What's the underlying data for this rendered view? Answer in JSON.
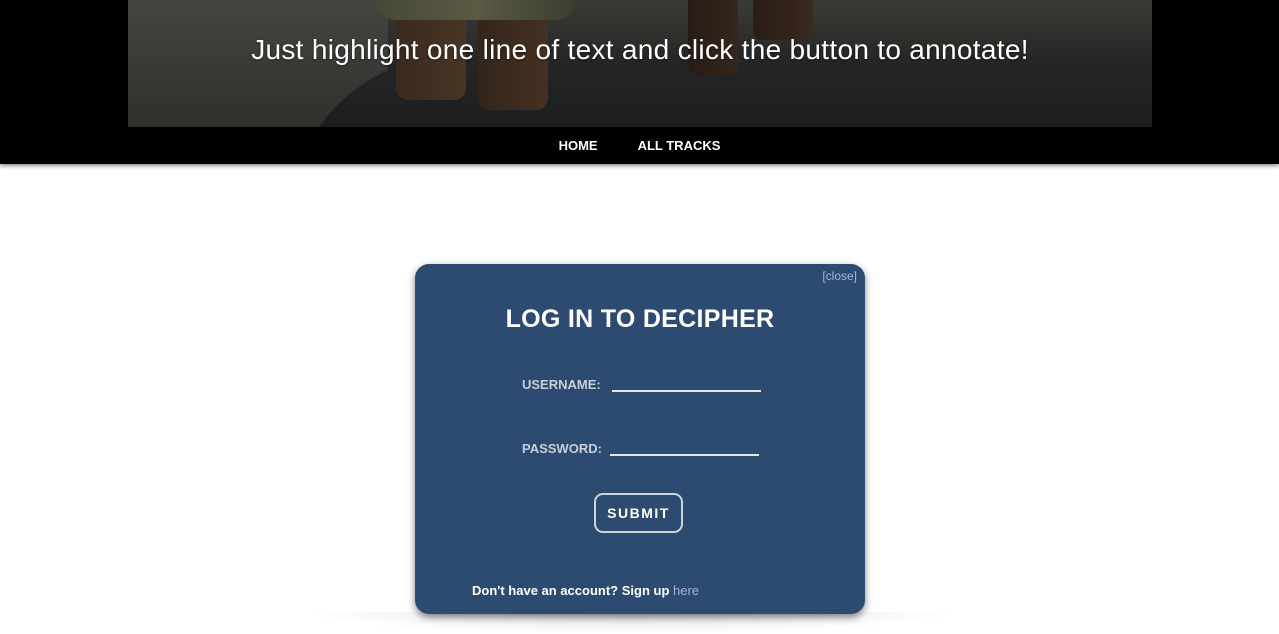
{
  "banner": {
    "text": "Just highlight one line of text and click the button to annotate!"
  },
  "nav": {
    "items": [
      {
        "label": "HOME"
      },
      {
        "label": "ALL TRACKS"
      }
    ]
  },
  "login_modal": {
    "close_label": "[close]",
    "title": "LOG IN TO DECIPHER",
    "username_label": "USERNAME:",
    "username_value": "",
    "password_label": "PASSWORD:",
    "password_value": "",
    "submit_label": "SUBMIT",
    "signup_text": "Don't have an account? Sign up",
    "signup_link": "here"
  },
  "colors": {
    "modal_background": "#2d4a70",
    "header_background": "#000000",
    "link": "#a6b6d3"
  }
}
